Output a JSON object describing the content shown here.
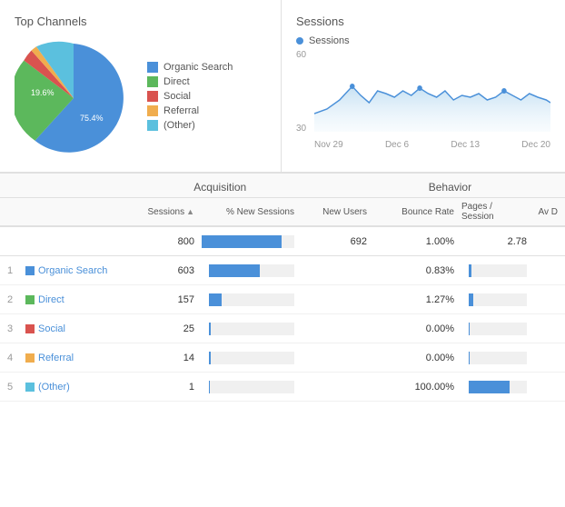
{
  "topChannels": {
    "title": "Top Channels",
    "legend": [
      {
        "label": "Organic Search",
        "color": "#4a90d9"
      },
      {
        "label": "Direct",
        "color": "#5cb85c"
      },
      {
        "label": "Social",
        "color": "#d9534f"
      },
      {
        "label": "Referral",
        "color": "#f0ad4e"
      },
      {
        "label": "(Other)",
        "color": "#5bc0de"
      }
    ],
    "pieSlices": [
      {
        "label": "Organic Search",
        "percent": 75.4,
        "color": "#4a90d9",
        "startAngle": 0,
        "endAngle": 271.44
      },
      {
        "label": "Direct",
        "percent": 19.6,
        "color": "#5cb85c",
        "startAngle": 271.44,
        "endAngle": 342.0
      },
      {
        "label": "Social",
        "percent": 2.5,
        "color": "#d9534f",
        "startAngle": 342.0,
        "endAngle": 351.0
      },
      {
        "label": "Referral",
        "percent": 1.8,
        "color": "#f0ad4e",
        "startAngle": 351.0,
        "endAngle": 357.48
      },
      {
        "label": "(Other)",
        "percent": 0.7,
        "color": "#5bc0de",
        "startAngle": 357.48,
        "endAngle": 360.0
      }
    ],
    "label754": "75.4%",
    "label196": "19.6%"
  },
  "sessions": {
    "title": "Sessions",
    "legendLabel": "Sessions",
    "yAxisLabels": [
      "60",
      "30"
    ],
    "xAxisLabels": [
      "Nov 29",
      "Dec 6",
      "Dec 13",
      "Dec 20"
    ]
  },
  "table": {
    "acquisitionLabel": "Acquisition",
    "behaviorLabel": "Behavior",
    "columns": {
      "sessions": "Sessions",
      "newSessions": "% New Sessions",
      "newUsers": "New Users",
      "bounceRate": "Bounce Rate",
      "pagesSession": "Pages / Session",
      "avgDuration": "Av D"
    },
    "totalRow": {
      "sessions": "800",
      "newSessionsBar": 86.5,
      "newSessionsVal": "86.50%",
      "newUsers": "692",
      "bounceRate": "1.00%",
      "pagesSession": "2.78"
    },
    "rows": [
      {
        "num": "1",
        "channel": "Organic Search",
        "color": "#4a90d9",
        "sessions": "603",
        "newSessionsBar": 60,
        "bounceRate": "0.83%",
        "pagesBar": 5
      },
      {
        "num": "2",
        "channel": "Direct",
        "color": "#5cb85c",
        "sessions": "157",
        "newSessionsBar": 15,
        "bounceRate": "1.27%",
        "pagesBar": 8
      },
      {
        "num": "3",
        "channel": "Social",
        "color": "#d9534f",
        "sessions": "25",
        "newSessionsBar": 2,
        "bounceRate": "0.00%",
        "pagesBar": 2
      },
      {
        "num": "4",
        "channel": "Referral",
        "color": "#f0ad4e",
        "sessions": "14",
        "newSessionsBar": 2,
        "bounceRate": "0.00%",
        "pagesBar": 2
      },
      {
        "num": "5",
        "channel": "(Other)",
        "color": "#5bc0de",
        "sessions": "1",
        "newSessionsBar": 1,
        "bounceRate": "100.00%",
        "pagesBar": 70
      }
    ]
  }
}
